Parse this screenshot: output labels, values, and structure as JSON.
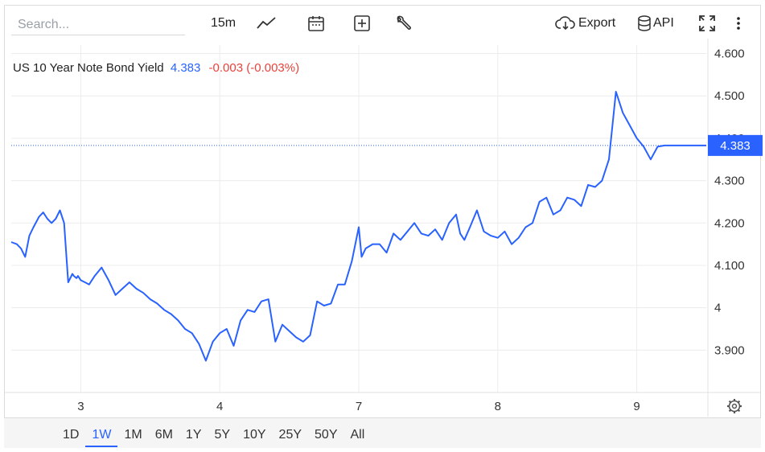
{
  "toolbar": {
    "search_placeholder": "Search...",
    "interval": "15m",
    "export_label": "Export",
    "api_label": "API"
  },
  "legend": {
    "title": "US 10 Year Note Bond Yield",
    "last": "4.383",
    "change": "-0.003 (-0.003%)"
  },
  "ranges": [
    "1D",
    "1W",
    "1M",
    "6M",
    "1Y",
    "5Y",
    "10Y",
    "25Y",
    "50Y",
    "All"
  ],
  "active_range": "1W",
  "colors": {
    "line": "#2962ff",
    "negative": "#e8433b",
    "grid": "#ececec"
  },
  "chart_data": {
    "type": "line",
    "title": "US 10 Year Note Bond Yield",
    "x_ticks": [
      "3",
      "4",
      "7",
      "8",
      "9"
    ],
    "x_tick_positions": [
      0.5,
      1.5,
      2.5,
      3.5,
      4.5
    ],
    "y_ticks": [
      "4.600",
      "4.500",
      "4.400",
      "4.300",
      "4.200",
      "4.100",
      "4",
      "3.900"
    ],
    "ylim": [
      3.8,
      4.62
    ],
    "xlim": [
      0,
      5.0
    ],
    "last_value_label": "4.383",
    "last_value": 4.383,
    "grid": true,
    "series": [
      {
        "x": [
          0.0,
          0.04,
          0.07,
          0.1,
          0.13,
          0.16,
          0.2,
          0.23,
          0.26,
          0.29,
          0.32,
          0.35,
          0.38,
          0.41,
          0.44,
          0.45,
          0.47,
          0.48,
          0.5,
          0.53,
          0.56,
          0.6,
          0.65,
          0.7,
          0.75,
          0.8,
          0.85,
          0.9,
          0.95,
          1.0,
          1.05,
          1.1,
          1.15,
          1.2,
          1.25,
          1.3,
          1.35,
          1.4,
          1.45,
          1.5,
          1.55,
          1.6,
          1.65,
          1.7,
          1.75,
          1.8,
          1.85,
          1.9,
          1.95,
          2.0,
          2.05,
          2.1,
          2.15,
          2.2,
          2.25,
          2.3,
          2.35,
          2.4,
          2.45,
          2.5,
          2.52,
          2.55,
          2.6,
          2.65,
          2.7,
          2.75,
          2.8,
          2.85,
          2.9,
          2.95,
          3.0,
          3.05,
          3.1,
          3.15,
          3.2,
          3.23,
          3.26,
          3.3,
          3.35,
          3.4,
          3.45,
          3.5,
          3.55,
          3.6,
          3.65,
          3.7,
          3.75,
          3.8,
          3.85,
          3.9,
          3.95,
          4.0,
          4.05,
          4.1,
          4.15,
          4.2,
          4.25,
          4.3,
          4.35,
          4.4,
          4.45,
          4.5,
          4.55,
          4.6,
          4.65,
          4.7,
          4.75,
          4.8,
          4.85,
          4.88,
          4.91,
          4.95,
          5.0
        ],
        "y": [
          4.155,
          4.15,
          4.14,
          4.12,
          4.17,
          4.19,
          4.215,
          4.225,
          4.21,
          4.2,
          4.21,
          4.23,
          4.2,
          4.06,
          4.08,
          4.075,
          4.07,
          4.075,
          4.065,
          4.06,
          4.055,
          4.075,
          4.095,
          4.065,
          4.03,
          4.045,
          4.06,
          4.045,
          4.035,
          4.02,
          4.01,
          3.995,
          3.985,
          3.97,
          3.95,
          3.94,
          3.915,
          3.875,
          3.92,
          3.94,
          3.95,
          3.91,
          3.97,
          3.995,
          3.99,
          4.015,
          4.02,
          3.92,
          3.96,
          3.945,
          3.93,
          3.92,
          3.935,
          4.015,
          4.005,
          4.01,
          4.055,
          4.055,
          4.11,
          4.19,
          4.12,
          4.14,
          4.15,
          4.15,
          4.13,
          4.175,
          4.16,
          4.18,
          4.2,
          4.175,
          4.17,
          4.185,
          4.16,
          4.2,
          4.22,
          4.175,
          4.16,
          4.19,
          4.23,
          4.18,
          4.17,
          4.165,
          4.18,
          4.15,
          4.165,
          4.19,
          4.2,
          4.25,
          4.26,
          4.22,
          4.23,
          4.26,
          4.255,
          4.24,
          4.29,
          4.285,
          4.3,
          4.35,
          4.51,
          4.46,
          4.43,
          4.4,
          4.38,
          4.35,
          4.38,
          4.383,
          4.383,
          4.383,
          4.383,
          4.383,
          4.383,
          4.383,
          4.383
        ]
      }
    ]
  }
}
